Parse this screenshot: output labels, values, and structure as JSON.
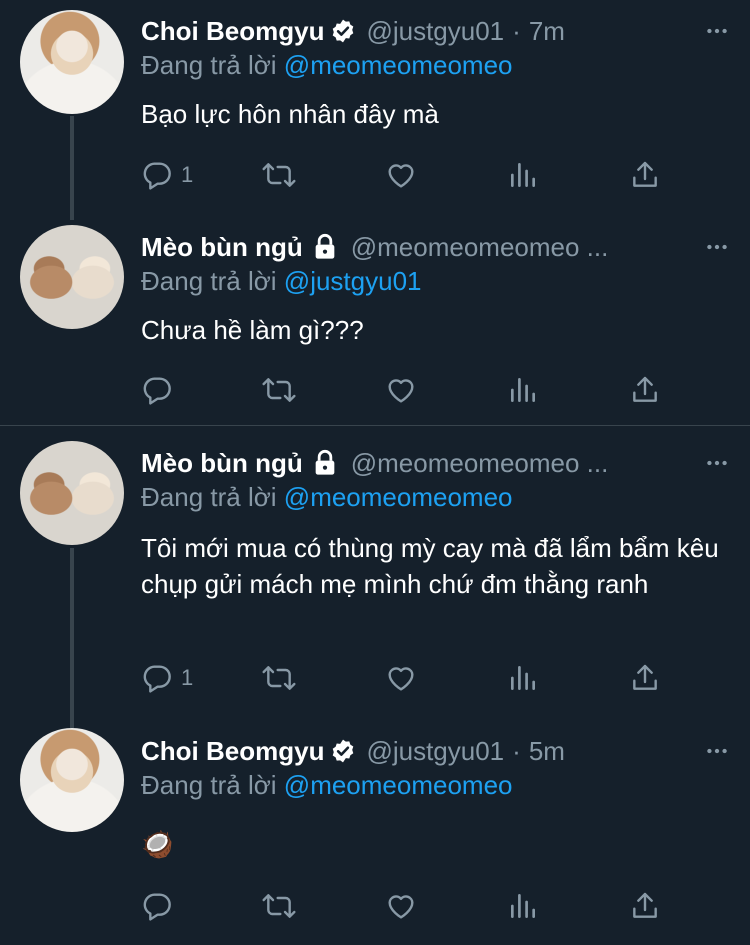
{
  "tweets": [
    {
      "name": "Choi Beomgyu",
      "handle": "@justgyu01",
      "separator": "·",
      "time": "7m",
      "reply_prefix": "Đang trả lời",
      "reply_to": "@meomeomeomeo",
      "text": "Bạo lực hôn nhân đây mà",
      "reply_count": "1",
      "verified": true
    },
    {
      "name": "Mèo bùn ngủ",
      "handle": "@meomeomeomeo ...",
      "reply_prefix": "Đang trả lời",
      "reply_to": "@justgyu01",
      "text": "Chưa hề làm gì???",
      "reply_count": "",
      "protected": true
    },
    {
      "name": "Mèo bùn ngủ",
      "handle": "@meomeomeomeo ...",
      "reply_prefix": "Đang trả lời",
      "reply_to": "@meomeomeomeo",
      "text": "Tôi mới mua có thùng mỳ cay mà đã lẩm bẩm kêu chụp gửi mách mẹ mình chứ đm thằng ranh",
      "reply_count": "1",
      "protected": true
    },
    {
      "name": "Choi Beomgyu",
      "handle": "@justgyu01",
      "separator": "·",
      "time": "5m",
      "reply_prefix": "Đang trả lời",
      "reply_to": "@meomeomeomeo",
      "text": "🥥",
      "reply_count": "",
      "verified": true
    }
  ],
  "icons": [
    "reply-icon",
    "retweet-icon",
    "like-icon",
    "analytics-icon",
    "share-icon",
    "more-icon",
    "verified-badge-icon",
    "lock-icon"
  ],
  "colors": {
    "background": "#15202b",
    "secondary_text": "#8899a6",
    "link": "#1da1f2",
    "divider": "#38444d"
  }
}
